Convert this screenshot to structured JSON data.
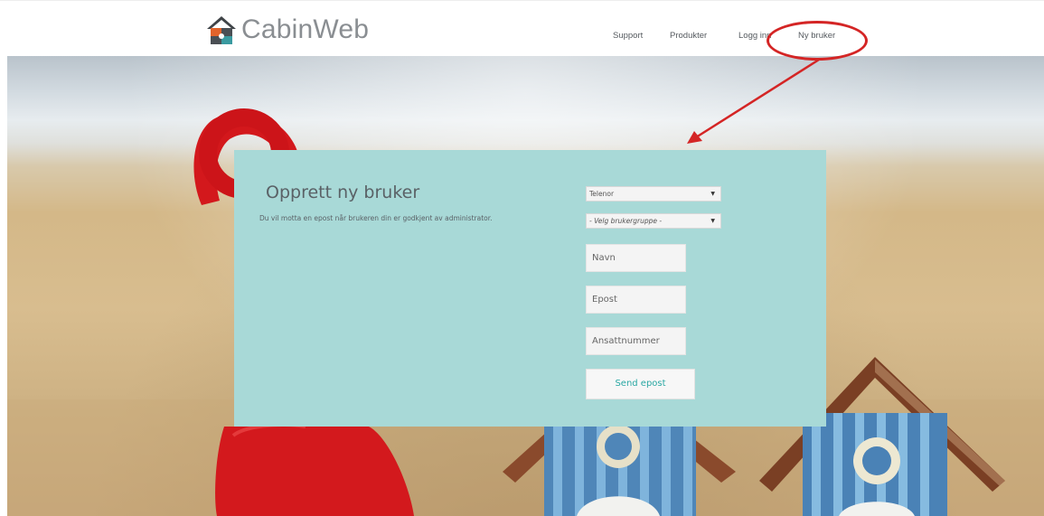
{
  "header": {
    "logo_text": "CabinWeb",
    "logo_icon": "cabin-puzzle-logo-icon",
    "nav": [
      {
        "label": "Support"
      },
      {
        "label": "Produkter"
      },
      {
        "label": "Logg inn"
      },
      {
        "label": "Ny bruker"
      }
    ],
    "highlighted_item": "Ny bruker"
  },
  "form": {
    "title": "Opprett ny bruker",
    "description": "Du vil motta en epost når brukeren din er godkjent av administrator.",
    "company_select": {
      "value": "Telenor"
    },
    "group_select": {
      "value": "- Velg brukergruppe -"
    },
    "name_field": {
      "placeholder": "Navn"
    },
    "email_field": {
      "placeholder": "Epost"
    },
    "employee_number_field": {
      "placeholder": "Ansattnummer"
    },
    "submit_label": "Send epost"
  },
  "colors": {
    "panel": "#a8d9d7",
    "button_text": "#2aa7a3",
    "annotation": "#d42525",
    "logo_text": "#8a8e92"
  }
}
